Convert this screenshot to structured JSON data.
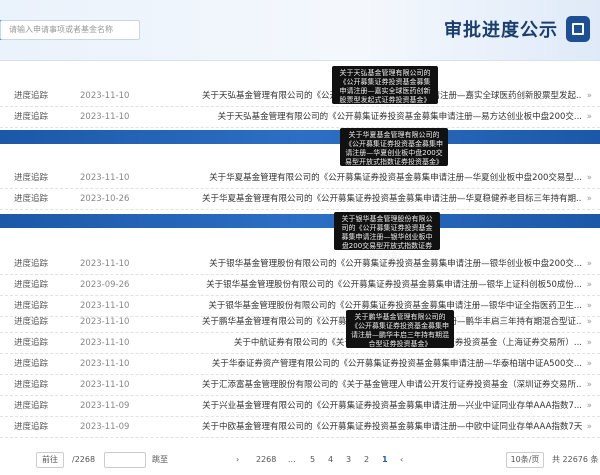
{
  "header": {
    "title": "审批进度公示",
    "search_placeholder": "请输入申请事项或者基金名称"
  },
  "sections": [
    {
      "rows": [
        {
          "title": "关于天弘基金管理有限公司的《公开募集证券投资基金募集申请注册—嘉实全球医药创新股票型发起...",
          "date": "2023-11-10",
          "status": "进度追踪"
        },
        {
          "title": "关于天弘基金管理有限公司的《公开募集证券投资基金募集申请注册—易方达创业板中盘200交...",
          "date": "2023-11-10",
          "status": "进度追踪"
        }
      ],
      "tooltip": "关于天弘基金管理有限公司的《公开募集证券投资基金募集申请注册—嘉实全球医药创新股票型发起式证券投资基金》"
    },
    {
      "rows": [
        {
          "title": "关于华夏基金管理有限公司的《公开募集证券投资基金募集申请注册—华夏创业板中盘200交易型...",
          "date": "2023-11-10",
          "status": "进度追踪"
        },
        {
          "title": "关于华夏基金管理有限公司的《公开募集证券投资基金募集申请注册—华夏稳健养老目标三年持有期...",
          "date": "2023-10-26",
          "status": "进度追踪"
        }
      ],
      "tooltip": "关于华夏基金管理有限公司的《公开募集证券投资基金募集申请注册—华夏创业板中盘200交易型开放式指数证券投资基金》"
    },
    {
      "rows": [
        {
          "title": "关于银华基金管理股份有限公司的《公开募集证券投资基金募集申请注册—银华创业板中盘200交...",
          "date": "2023-11-10",
          "status": "进度追踪"
        },
        {
          "title": "关于银华基金管理股份有限公司的《公开募集证券投资基金募集申请注册—银华上证科创板50成份...",
          "date": "2023-09-26",
          "status": "进度追踪"
        },
        {
          "title": "关于银华基金管理股份有限公司的《公开募集证券投资基金募集申请注册—银华中证全指医药卫生...",
          "date": "2023-11-10",
          "status": "进度追踪"
        }
      ],
      "tooltip": "关于银华基金管理股份有限公司的《公开募集证券投资基金募集申请注册—银华创业板中盘200交易型开放式指数证券投资基金》"
    },
    {
      "rows": [
        {
          "title": "关于鹏华基金管理有限公司的《公开募集证券投资基金募集申请注册—鹏华丰启三年持有期混合型证...",
          "date": "2023-11-10",
          "status": "进度追踪"
        },
        {
          "title": "关于中航证券有限公司的《关于基金管理人申请公开发行证券投资基金（上海证券交易所）...",
          "date": "2023-11-10",
          "status": "进度追踪"
        },
        {
          "title": "关于华泰证券资产管理有限公司的《公开募集证券投资基金募集申请注册—华泰柏瑞中证A500交...",
          "date": "2023-11-10",
          "status": "进度追踪"
        },
        {
          "title": "关于汇添富基金管理股份有限公司的《关于基金管理人申请公开发行证券投资基金（深圳证券交易所...",
          "date": "2023-11-10",
          "status": "进度追踪"
        },
        {
          "title": "关于兴业基金管理有限公司的《公开募集证券投资基金募集申请注册—兴业中证同业存单AAA指数7...",
          "date": "2023-11-09",
          "status": "进度追踪"
        },
        {
          "title": "关于中欧基金管理有限公司的《公开募集证券投资基金募集申请注册—中欧中证同业存单AAA指数7天...",
          "date": "2023-11-09",
          "status": "进度追踪"
        }
      ],
      "tooltip": "关于鹏华基金管理有限公司的《公开募集证券投资基金募集申请注册—鹏华丰启三年持有期混合型证券投资基金》"
    }
  ],
  "pagination": {
    "total": "共 22676 条",
    "page_size": "10条/页",
    "pages": [
      "1",
      "2",
      "3",
      "4",
      "5",
      "...",
      "2268"
    ],
    "prev": "‹",
    "next": "›",
    "goto_label": "跳至",
    "goto_suffix": "/2268",
    "jump_button": "前往"
  }
}
